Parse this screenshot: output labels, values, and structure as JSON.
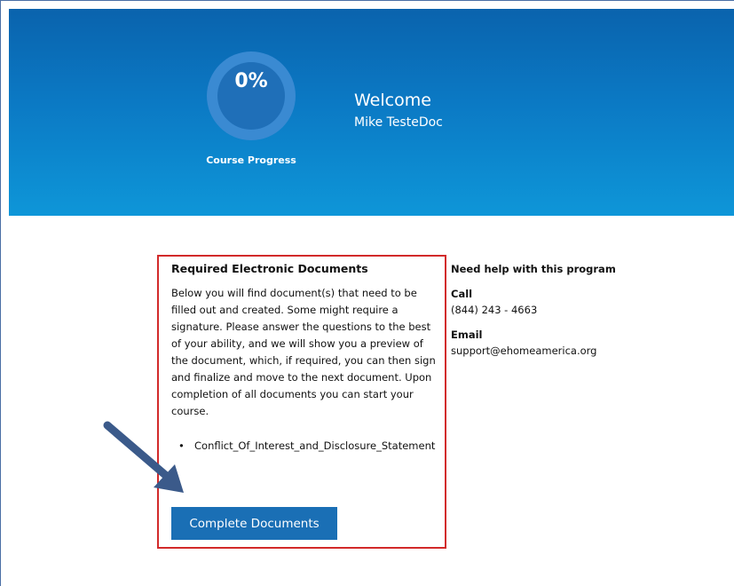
{
  "progress": {
    "value_text": "0%",
    "fraction": 0,
    "label": "Course Progress"
  },
  "greeting": {
    "title": "Welcome",
    "user_name": "Mike TesteDoc"
  },
  "documents": {
    "title": "Required Electronic Documents",
    "body": "Below you will find document(s) that need to be filled out and created.  Some might require a signature.  Please answer the questions to the best of your ability, and we will show you a preview of the document, which, if required, you can then sign and finalize and move to the next document.  Upon completion of all documents you can start your course.",
    "items": [
      {
        "name": "Conflict_Of_Interest_and_Disclosure_Statement"
      }
    ],
    "button_label": "Complete Documents"
  },
  "help": {
    "title": "Need help with this program",
    "call_label": "Call",
    "phone": "(844) 243 - 4663",
    "email_label": "Email",
    "email": "support@ehomeamerica.org"
  },
  "colors": {
    "hero_top": "#0a63ad",
    "hero_bottom": "#0e96d8",
    "button": "#1a6fb5",
    "highlight_box": "#d22a2a",
    "arrow": "#3b5a8a"
  },
  "icons": {
    "annotation": "arrow-pointer-icon"
  }
}
